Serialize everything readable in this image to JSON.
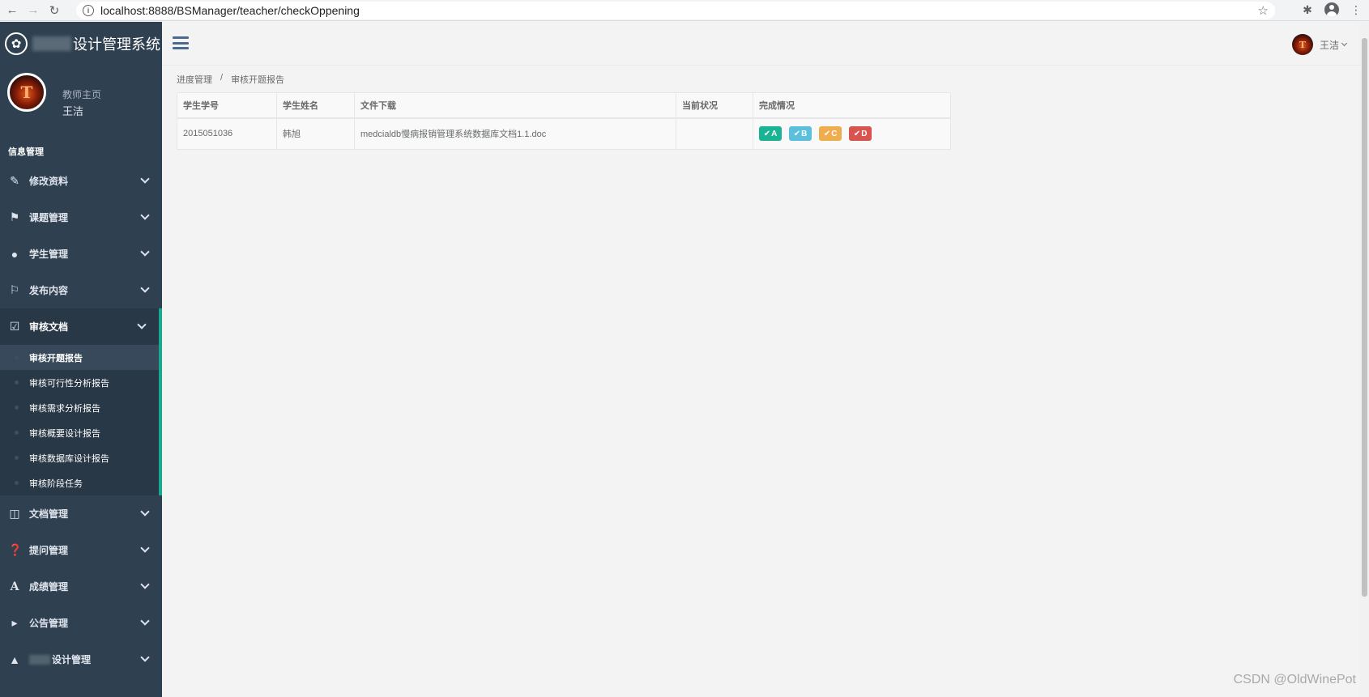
{
  "browser": {
    "url": "localhost:8888/BSManager/teacher/checkOppening"
  },
  "brand": {
    "title": "设计管理系统"
  },
  "profile": {
    "role": "教师主页",
    "name": "王洁"
  },
  "sidebar": {
    "section_title": "信息管理",
    "items": [
      {
        "label": "修改资料",
        "icon": "edit-icon"
      },
      {
        "label": "课题管理",
        "icon": "tags-icon"
      },
      {
        "label": "学生管理",
        "icon": "user-icon"
      },
      {
        "label": "发布内容",
        "icon": "flag-icon"
      }
    ],
    "active_group": {
      "label": "审核文档",
      "icon": "check-square-icon",
      "subitems": [
        "审核开题报告",
        "审核可行性分析报告",
        "审核需求分析报告",
        "审核概要设计报告",
        "审核数据库设计报告",
        "审核阶段任务"
      ]
    },
    "items_after": [
      {
        "label": "文档管理",
        "icon": "folder-open-icon"
      },
      {
        "label": "提问管理",
        "icon": "question-circle-icon"
      },
      {
        "label": "成绩管理",
        "icon": "font-icon"
      },
      {
        "label": "公告管理",
        "icon": "bullhorn-icon"
      },
      {
        "label": "设计管理",
        "icon": "graduation-cap-icon"
      }
    ]
  },
  "header": {
    "user_name": "王洁"
  },
  "breadcrumb": {
    "parent": "进度管理",
    "separator": "/",
    "current": "审核开题报告"
  },
  "table": {
    "headers": [
      "学生学号",
      "学生姓名",
      "文件下载",
      "当前状况",
      "完成情况"
    ],
    "rows": [
      {
        "student_id": "2015051036",
        "student_name": "韩旭",
        "file": "medcialdb慢病报销管理系统数据库文档1.1.doc",
        "status": "",
        "grades": [
          "A",
          "B",
          "C",
          "D"
        ]
      }
    ]
  },
  "colors": {
    "sidebar_bg": "#2f4050",
    "accent": "#19aa8d",
    "grade_a": "#1ab394",
    "grade_b": "#5bc0de",
    "grade_c": "#f0ad4e",
    "grade_d": "#d9534f"
  },
  "watermark": "CSDN @OldWinePot"
}
